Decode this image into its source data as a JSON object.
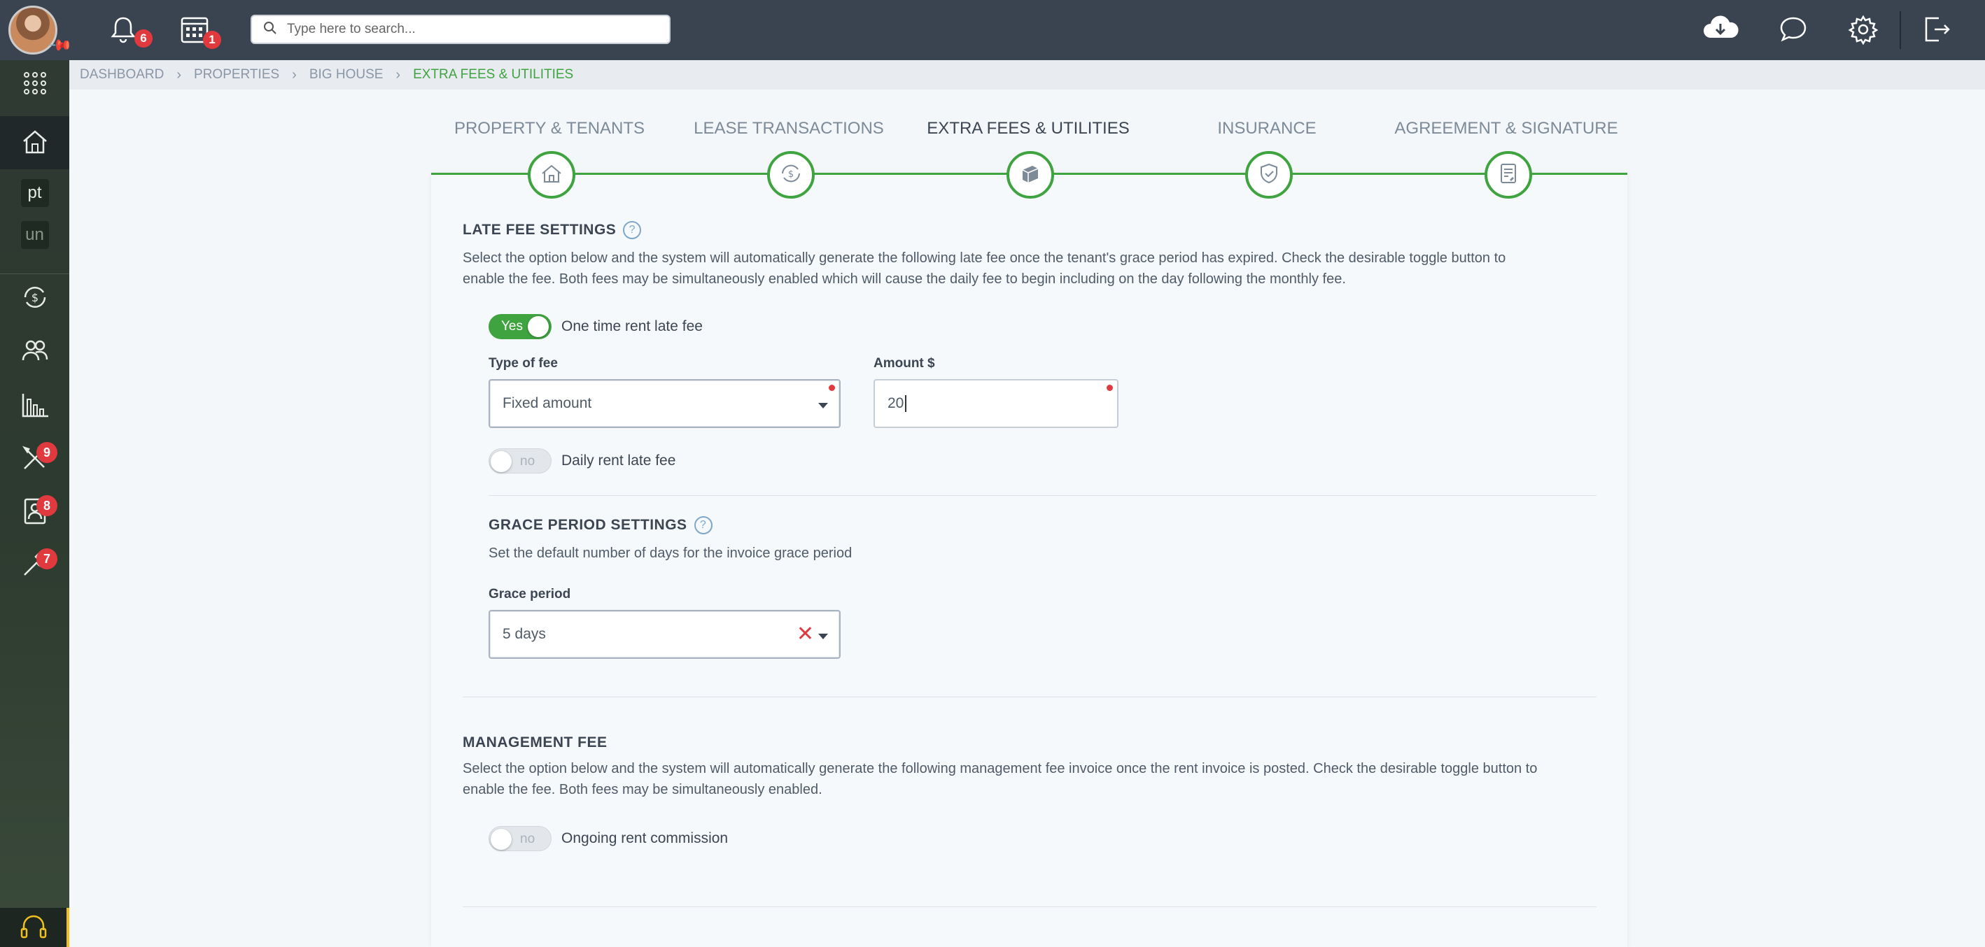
{
  "topbar": {
    "notifications_count": "6",
    "calendar_count": "1",
    "search_placeholder": "Type here to search..."
  },
  "sidebar": {
    "text_items": [
      "pt",
      "un"
    ],
    "badges": {
      "tools": "9",
      "contacts": "8",
      "maintenance": "7"
    }
  },
  "breadcrumb": [
    "DASHBOARD",
    "PROPERTIES",
    "BIG HOUSE",
    "EXTRA FEES & UTILITIES"
  ],
  "tabs": [
    {
      "label": "PROPERTY & TENANTS"
    },
    {
      "label": "LEASE TRANSACTIONS"
    },
    {
      "label": "EXTRA FEES & UTILITIES"
    },
    {
      "label": "INSURANCE"
    },
    {
      "label": "AGREEMENT & SIGNATURE"
    }
  ],
  "late_fee": {
    "title": "LATE FEE SETTINGS",
    "help": "?",
    "description_line1": "Select the option below and the system will automatically generate the following late fee once the tenant's grace period has expired. Check the desirable toggle button to",
    "description_line2": "enable the fee. Both fees may be simultaneously enabled which will cause the daily fee to begin including on the day following the monthly fee.",
    "one_time_toggle_text": "Yes",
    "one_time_label": "One time rent late fee",
    "type_label": "Type of fee",
    "type_value": "Fixed amount",
    "amount_label": "Amount $",
    "amount_value": "20",
    "daily_toggle_text": "no",
    "daily_label": "Daily rent late fee"
  },
  "grace_period": {
    "title": "GRACE PERIOD SETTINGS",
    "help": "?",
    "description": "Set the default number of days for the invoice grace period",
    "label": "Grace period",
    "value": "5 days"
  },
  "management_fee": {
    "title": "MANAGEMENT FEE",
    "description_line1": "Select the option below and the system will automatically generate the following management fee invoice once the rent invoice is posted. Check the desirable toggle button to",
    "description_line2": "enable the fee. Both fees may be simultaneously enabled.",
    "toggle_text": "no",
    "label": "Ongoing rent commission"
  },
  "colors": {
    "accent": "#3fa33f",
    "topbar": "#3a4450",
    "badge": "#e03a3e"
  }
}
